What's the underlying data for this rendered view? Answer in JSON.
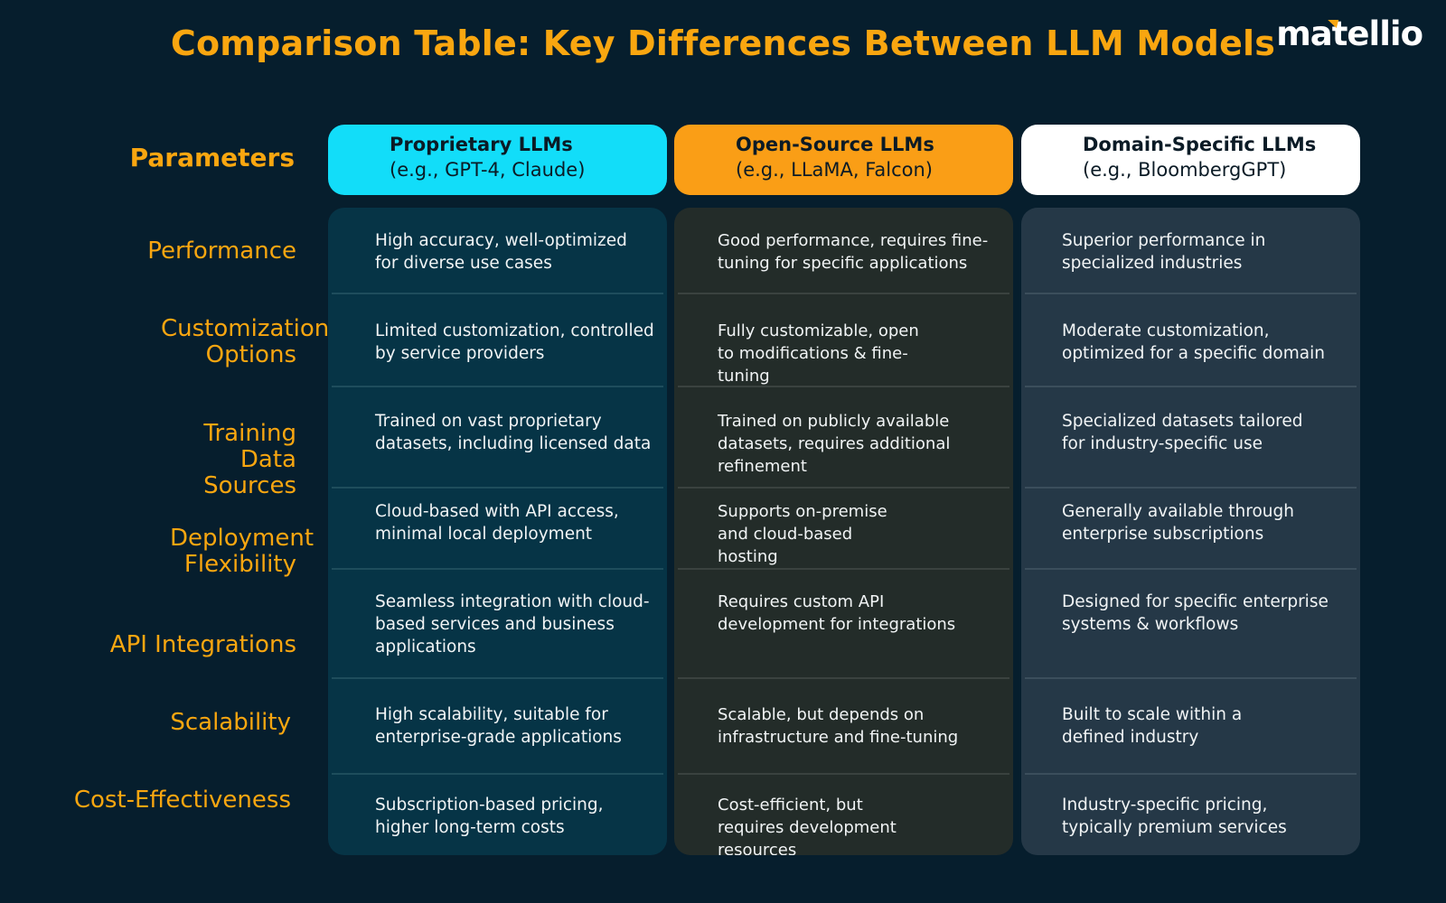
{
  "title": "Comparison Table: Key Differences Between LLM Models",
  "logo": {
    "text": "matellio",
    "brand_color": "#f9a610"
  },
  "colors": {
    "background": "#061e2d",
    "accent_orange": "#f9a610",
    "proprietary_header": "#12ddf9",
    "open_source_header": "#fa9e16",
    "domain_specific_header": "#ffffff"
  },
  "parameters_heading": "Parameters",
  "parameters": [
    "Performance",
    "Customization Options",
    "Training Data Sources",
    "Deployment Flexibility",
    "API Integrations",
    "Scalability",
    "Cost-Effectiveness"
  ],
  "columns": [
    {
      "name": "Proprietary LLMs",
      "examples": "(e.g., GPT-4, Claude)",
      "cells": [
        "High accuracy, well-optimized for diverse use cases",
        "Limited customization, controlled by service providers",
        "Trained on vast proprietary datasets, including licensed data",
        "Cloud-based with API access, minimal local deployment",
        "Seamless integration with cloud-based services and business applications",
        "High scalability, suitable for enterprise-grade applications",
        "Subscription-based pricing, higher long-term costs"
      ]
    },
    {
      "name": "Open-Source LLMs",
      "examples": "(e.g., LLaMA, Falcon)",
      "cells": [
        "Good performance, requires fine-tuning for specific applications",
        "Fully customizable, open to modifications & fine-tuning",
        "Trained on publicly available datasets, requires additional refinement",
        "Supports on-premise and cloud-based hosting",
        "Requires custom API development for integrations",
        "Scalable, but depends on infrastructure and fine-tuning",
        "Cost-efficient, but requires development resources"
      ]
    },
    {
      "name": "Domain-Specific LLMs",
      "examples": "(e.g., BloombergGPT)",
      "cells": [
        "Superior performance in specialized industries",
        "Moderate customization, optimized for a specific domain",
        "Specialized datasets tailored for industry-specific use",
        "Generally available through enterprise subscriptions",
        "Designed for specific enterprise systems & workflows",
        "Built to scale within a defined industry",
        "Industry-specific pricing, typically premium services"
      ]
    }
  ]
}
